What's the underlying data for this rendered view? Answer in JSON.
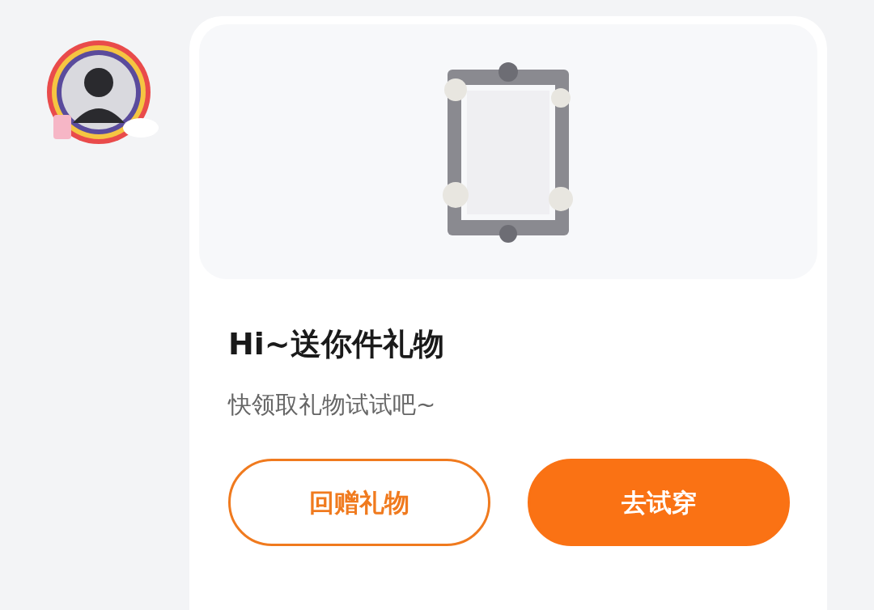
{
  "card": {
    "title": "Hi~送你件礼物",
    "subtitle": "快领取礼物试试吧~",
    "buttons": [
      {
        "label": "回赠礼物",
        "kind": "outline"
      },
      {
        "label": "去试穿",
        "kind": "filled"
      }
    ]
  }
}
